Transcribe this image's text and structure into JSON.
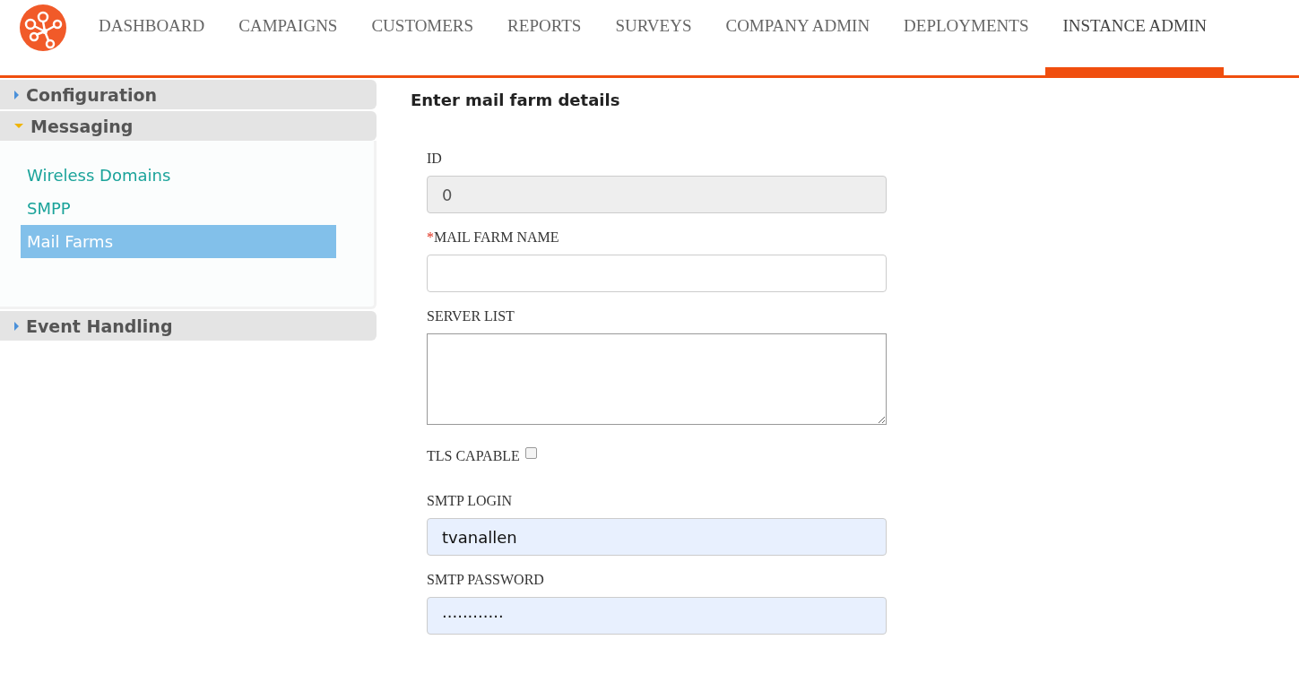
{
  "nav": {
    "tabs": [
      {
        "label": "DASHBOARD",
        "selected": false
      },
      {
        "label": "CAMPAIGNS",
        "selected": false
      },
      {
        "label": "CUSTOMERS",
        "selected": false
      },
      {
        "label": "REPORTS",
        "selected": false
      },
      {
        "label": "SURVEYS",
        "selected": false
      },
      {
        "label": "COMPANY ADMIN",
        "selected": false
      },
      {
        "label": "DEPLOYMENTS",
        "selected": false
      },
      {
        "label": "INSTANCE ADMIN",
        "selected": true
      }
    ]
  },
  "sidebar": {
    "sections": [
      {
        "title": "Configuration",
        "expanded": false
      },
      {
        "title": "Messaging",
        "expanded": true,
        "items": [
          {
            "label": "Wireless Domains",
            "selected": false
          },
          {
            "label": "SMPP",
            "selected": false
          },
          {
            "label": "Mail Farms",
            "selected": true
          }
        ]
      },
      {
        "title": "Event Handling",
        "expanded": false
      }
    ]
  },
  "form": {
    "title": "Enter mail farm details",
    "fields": [
      {
        "kind": "text",
        "label": "ID",
        "value": "0",
        "disabled": true,
        "autofilled": false
      },
      {
        "kind": "text",
        "required_mark": "*",
        "label": "MAIL FARM NAME",
        "disabled": false,
        "autofilled": false
      },
      {
        "kind": "textarea",
        "label": "SERVER LIST",
        "disabled": false,
        "autofilled": false
      },
      {
        "kind": "checkbox",
        "label": "TLS CAPABLE",
        "checked": false
      },
      {
        "kind": "text",
        "label": "SMTP LOGIN",
        "value": "tvanallen",
        "disabled": false,
        "autofilled": true
      },
      {
        "kind": "text",
        "label": "SMTP PASSWORD",
        "value": "············",
        "disabled": false,
        "autofilled": true
      }
    ]
  }
}
